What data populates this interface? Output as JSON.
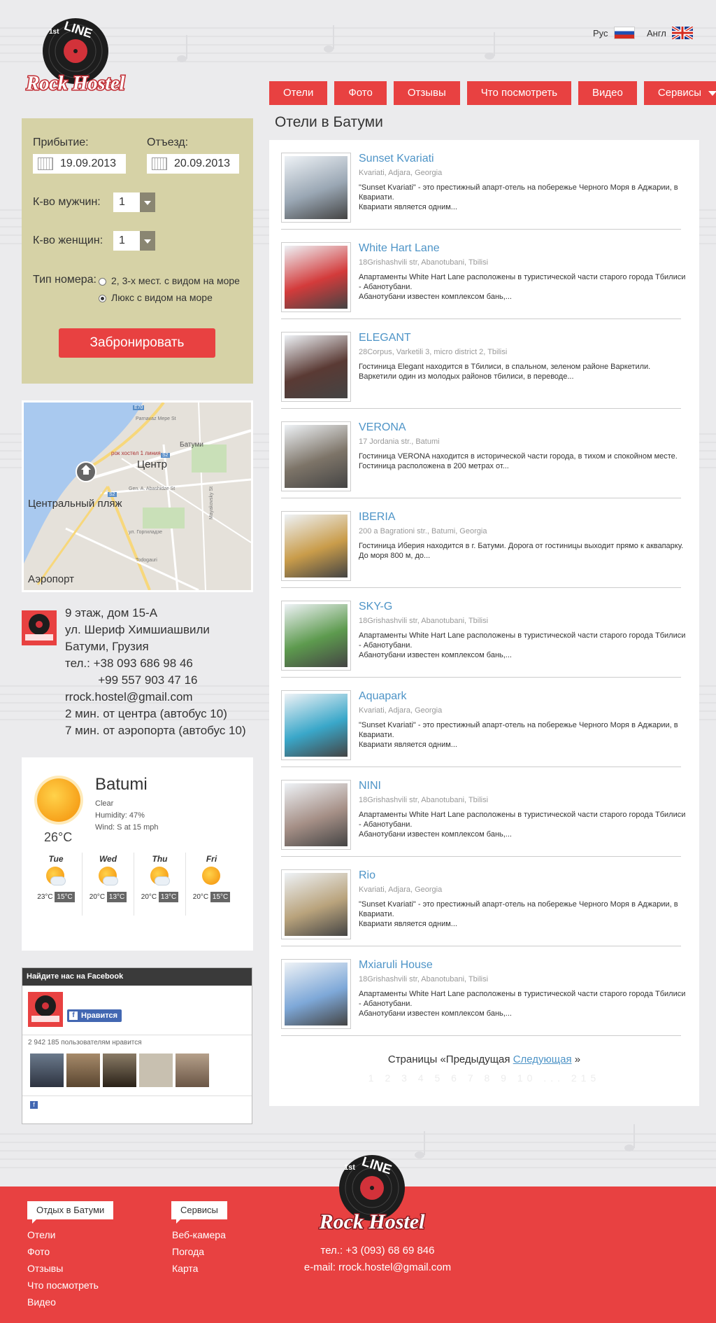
{
  "header": {
    "lang_ru": "Рус",
    "lang_en": "Англ",
    "logo_line": "LINE",
    "logo_first": "1st",
    "logo_name": "Rock Hostel"
  },
  "nav": {
    "items": [
      "Отели",
      "Фото",
      "Отзывы",
      "Что посмотреть",
      "Видео",
      "Сервисы"
    ]
  },
  "booking": {
    "arrival_label": "Прибытие:",
    "arrival_value": "19.09.2013",
    "departure_label": "Отъезд:",
    "departure_value": "20.09.2013",
    "men_label": "К-во мужчин:",
    "men_value": "1",
    "women_label": "К-во женщин:",
    "women_value": "1",
    "room_type_label": "Тип номера:",
    "room_option_1": "2, 3-х мест. с видом на море",
    "room_option_2": "Люкс с видом на море",
    "book_button": "Забронировать"
  },
  "map": {
    "label_center": "Центр",
    "label_beach": "Центральный пляж",
    "label_airport": "Аэропорт",
    "label_batumi": "Батуми",
    "label_hostel": "рок хостел 1 линия",
    "street_1": "Parnavaz Mepe St",
    "street_2": "Gen. A. Abashidze St",
    "street_3": "ул. Горгиладзе",
    "street_4": "Todogauri",
    "street_5": "Mayakovsky St",
    "road_badge_1": "E70",
    "road_badge_2": "Š2",
    "road_badge_3": "Š2"
  },
  "contacts": {
    "lines": [
      "9 этаж, дом 15-А",
      "ул. Шериф Химшиашвили",
      "Батуми, Грузия",
      "тел.: +38 093 686 98 46",
      "          +99 557 903 47 16",
      "rrock.hostel@gmail.com",
      "2 мин. от центра (автобус 10)",
      "7 мин. от аэропорта (автобус 10)"
    ]
  },
  "weather": {
    "city": "Batumi",
    "condition": "Clear",
    "humidity": "Humidity: 47%",
    "wind": "Wind: S at 15 mph",
    "temp": "26°C",
    "days": [
      {
        "day": "Tue",
        "hi": "23°C",
        "lo": "15°C"
      },
      {
        "day": "Wed",
        "hi": "20°C",
        "lo": "13°C"
      },
      {
        "day": "Thu",
        "hi": "20°C",
        "lo": "13°C"
      },
      {
        "day": "Fri",
        "hi": "20°C",
        "lo": "15°C"
      }
    ]
  },
  "facebook": {
    "header": "Найдите нас на Facebook",
    "like_button": "Нравится",
    "likes_text": "2 942 185 пользователям нравится"
  },
  "main": {
    "title": "Отели в Батуми",
    "hotels": [
      {
        "name": "Sunset Kvariati",
        "address": "Kvariati, Adjara, Georgia",
        "desc": "\"Sunset Kvariati\" - это престижный апарт-отель на побережье Черного Моря в Аджарии, в Квариати.",
        "desc2": "Квариати является одним...",
        "color": "#9aa7b4"
      },
      {
        "name": "White Hart Lane",
        "address": "18Grishashvili str, Abanotubani, Tbilisi",
        "desc": "Апартаменты White Hart Lane расположены в туристической части старого города Тбилиси - Абанотубани.",
        "desc2": "Абанотубани известен комплексом бань,...",
        "color": "#d33b3b"
      },
      {
        "name": "ELEGANT",
        "address": "28Corpus, Varketili 3, micro district 2, Tbilisi",
        "desc": "Гостиница Elegant находится в Тбилиси, в спальном, зеленом районе Варкетили. Варкетили один из молодых районов тбилиси, в переводе...",
        "desc2": "",
        "color": "#5a3a34"
      },
      {
        "name": "VERONA",
        "address": "17 Jordania str., Batumi",
        "desc": "Гостиница VERONA находится в исторической части города, в тихом и спокойном месте. Гостиница расположена в 200 метрах от...",
        "desc2": "",
        "color": "#7d7468"
      },
      {
        "name": "IBERIA",
        "address": "200 a Bagrationi str., Batumi, Georgia",
        "desc": "Гостиница Иберия находится в г. Батуми. Дорога от гостиницы выходит прямо к аквапарку. До моря 800 м, до...",
        "desc2": "",
        "color": "#c99c4a"
      },
      {
        "name": "SKY-G",
        "address": "18Grishashvili str, Abanotubani, Tbilisi",
        "desc": "Апартаменты White Hart Lane расположены в туристической части старого города Тбилиси - Абанотубани.",
        "desc2": "Абанотубани известен комплексом бань,...",
        "color": "#5d9a4e"
      },
      {
        "name": "Aquapark",
        "address": "Kvariati, Adjara, Georgia",
        "desc": "\"Sunset Kvariati\" - это престижный апарт-отель на побережье Черного Моря в Аджарии, в Квариати.",
        "desc2": "Квариати является одним...",
        "color": "#3aa7c9"
      },
      {
        "name": "NINI",
        "address": "18Grishashvili str, Abanotubani, Tbilisi",
        "desc": "Апартаменты White Hart Lane расположены в туристической части старого города Тбилиси - Абанотубани.",
        "desc2": "Абанотубани известен комплексом бань,...",
        "color": "#a58f86"
      },
      {
        "name": "Rio",
        "address": "Kvariati, Adjara, Georgia",
        "desc": "\"Sunset Kvariati\" - это престижный апарт-отель на побережье Черного Моря в Аджарии, в Квариати.",
        "desc2": "Квариати является одним...",
        "color": "#b9a37c"
      },
      {
        "name": "Mxiaruli House",
        "address": "18Grishashvili str, Abanotubani, Tbilisi",
        "desc": "Апартаменты White Hart Lane расположены в туристической части старого города Тбилиси - Абанотубани.",
        "desc2": "Абанотубани известен комплексом бань,...",
        "color": "#7ea8d8"
      }
    ],
    "pager_prefix": "Страницы «Предыдущая",
    "pager_next": "Следующая",
    "pager_suffix": "»",
    "page_numbers": "1 2 3 4 5 6 7 8 9 10 ... 215"
  },
  "footer": {
    "tab_rest": "Отдых в Батуми",
    "tab_services": "Сервисы",
    "links_rest": [
      "Отели",
      "Фото",
      "Отзывы",
      "Что посмотреть",
      "Видео"
    ],
    "links_services": [
      "Веб-камера",
      "Погода",
      "Карта"
    ],
    "phone": "тел.: +3 (093) 68 69 846",
    "email": "e-mail: rrock.hostel@gmail.com"
  },
  "colors": {
    "accent": "#e84141",
    "link": "#4e94c7",
    "booking_bg": "#d6d2a6"
  }
}
